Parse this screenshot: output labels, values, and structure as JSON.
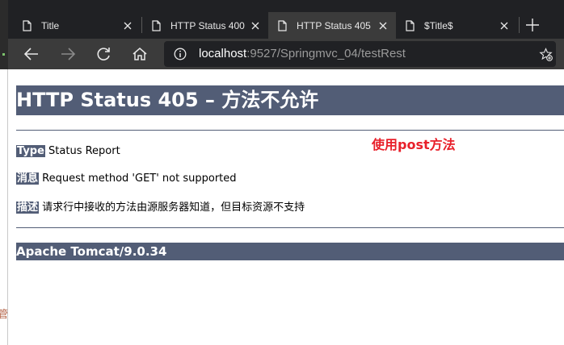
{
  "tabs": [
    {
      "title": "Title",
      "active": false
    },
    {
      "title": "HTTP Status 400",
      "active": false
    },
    {
      "title": "HTTP Status 405",
      "active": true
    },
    {
      "title": "$Title$",
      "active": false
    }
  ],
  "address_bar": {
    "host": "localhost",
    "path": ":9527/Springmvc_04/testRest"
  },
  "page": {
    "heading": "HTTP Status 405 – 方法不允许",
    "type_label": "Type",
    "type_value": " Status Report",
    "message_label": "消息",
    "message_value": " Request method 'GET' not supported",
    "description_label": "描述",
    "description_value": " 请求行中接收的方法由源服务器知道，但目标资源不支持",
    "footer": "Apache Tomcat/9.0.34"
  },
  "annotation": "使用post方法",
  "left_edge_char": "管",
  "colors": {
    "tomcat_bar": "#525d76",
    "annotation": "#e8202a",
    "tabbar_bg": "#202124",
    "toolbar_bg": "#3b3b3b"
  }
}
